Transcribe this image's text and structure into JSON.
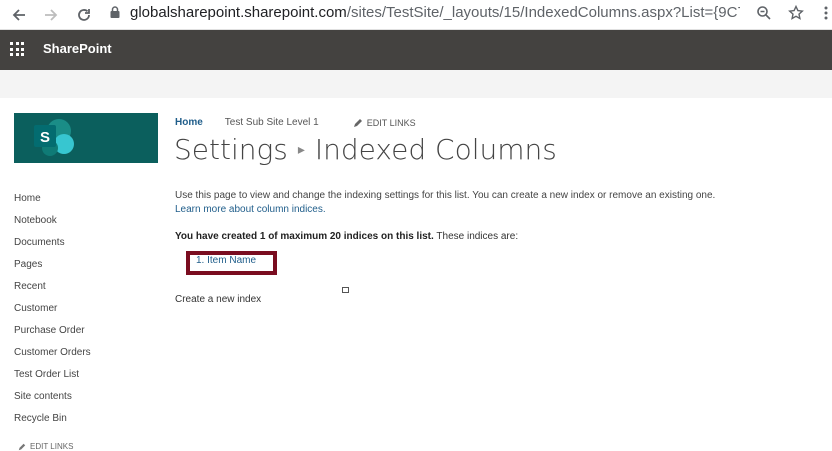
{
  "browser": {
    "url_host": "globalsharepoint.sharepoint.com",
    "url_path": "/sites/TestSite/_layouts/15/IndexedColumns.aspx?List={9C744F..."
  },
  "suite": {
    "brand": "SharePoint"
  },
  "breadcrumb": {
    "home": "Home",
    "sub_site": "Test Sub Site Level 1",
    "edit_links": "EDIT LINKS"
  },
  "title": {
    "parent": "Settings",
    "current": "Indexed Columns"
  },
  "left_nav": {
    "items": [
      {
        "label": "Home"
      },
      {
        "label": "Notebook"
      },
      {
        "label": "Documents"
      },
      {
        "label": "Pages"
      },
      {
        "label": "Recent"
      },
      {
        "label": "Customer"
      },
      {
        "label": "Purchase Order"
      },
      {
        "label": "Customer Orders"
      },
      {
        "label": "Test Order List"
      },
      {
        "label": "Site contents"
      },
      {
        "label": "Recycle Bin"
      }
    ],
    "edit_links": "EDIT LINKS"
  },
  "content": {
    "description": "Use this page to view and change the indexing settings for this list. You can create a new index or remove an existing one.",
    "learn_more": "Learn more about column indices.",
    "count_bold": "You have created 1 of maximum 20 indices on this list.",
    "count_rest": " These indices are:",
    "indices": [
      "1. Item Name"
    ],
    "create_link": "Create a new index"
  },
  "colors": {
    "suite_bar": "#444240",
    "logo_bg": "#0b5f5d",
    "link": "#1f5d8a",
    "highlight_border": "#7a0d20"
  }
}
